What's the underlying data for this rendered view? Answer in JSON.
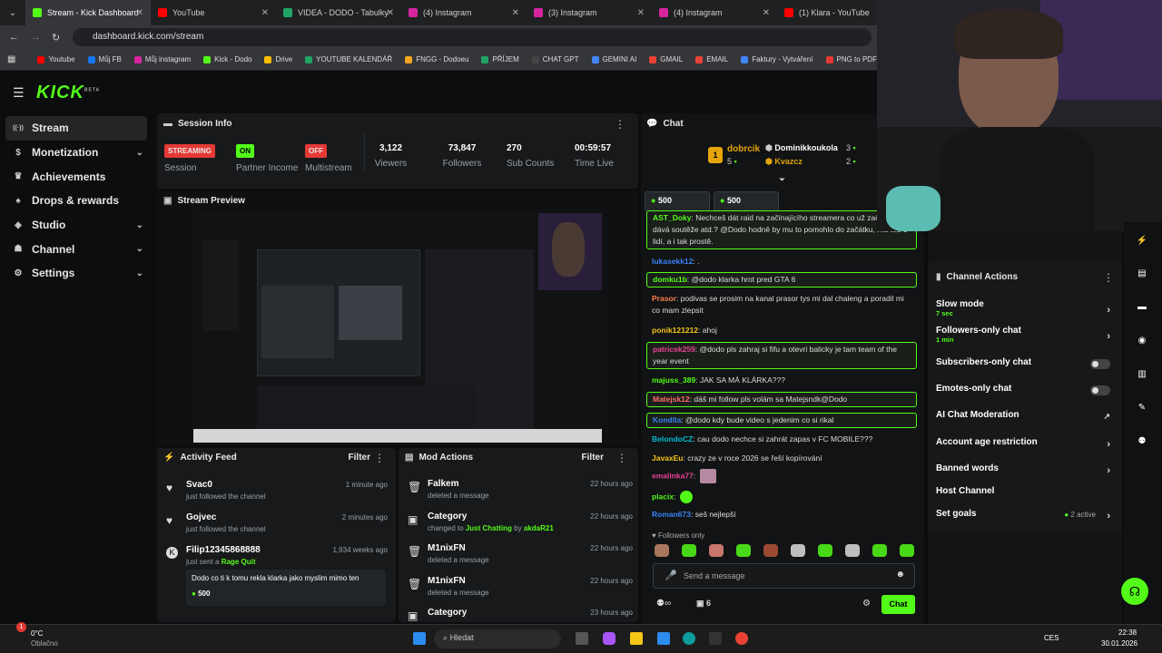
{
  "browser": {
    "tabs": [
      {
        "label": "Stream - Kick Dashboard",
        "color": "#53fc18",
        "active": true
      },
      {
        "label": "YouTube",
        "color": "#ff0000"
      },
      {
        "label": "VIDEA - DODO - Tabulky",
        "color": "#1fa463"
      },
      {
        "label": "(4) Instagram",
        "color": "#d6249f"
      },
      {
        "label": "(3) Instagram",
        "color": "#d6249f"
      },
      {
        "label": "(4) Instagram",
        "color": "#d6249f"
      },
      {
        "label": "(1) Klara - YouTube",
        "color": "#ff0000"
      }
    ],
    "url": "dashboard.kick.com/stream",
    "bookmarks": [
      {
        "label": "Youtube",
        "color": "#ff0000"
      },
      {
        "label": "Můj FB",
        "color": "#1877f2"
      },
      {
        "label": "Můj instagram",
        "color": "#d6249f"
      },
      {
        "label": "Kick - Dodo",
        "color": "#53fc18"
      },
      {
        "label": "Drive",
        "color": "#fbbc04"
      },
      {
        "label": "YOUTUBE KALENDÁŘ",
        "color": "#1fa463"
      },
      {
        "label": "FNGG - Dodoeu",
        "color": "#f5a623"
      },
      {
        "label": "PŘÍJEM",
        "color": "#1fa463"
      },
      {
        "label": "CHAT GPT",
        "color": "#444444"
      },
      {
        "label": "GEMINI AI",
        "color": "#4285f4"
      },
      {
        "label": "GMAIL",
        "color": "#ea4335"
      },
      {
        "label": "EMAIL",
        "color": "#ea4335"
      },
      {
        "label": "Faktury - Vytváření",
        "color": "#4285f4"
      },
      {
        "label": "PNG to PDF",
        "color": "#e53935"
      }
    ]
  },
  "brand": {
    "logo": "KICK",
    "beta": "BETA",
    "accent": "#53fc18"
  },
  "sidebar": {
    "items": [
      {
        "label": "Stream",
        "icon": "broadcast-icon",
        "chev": ""
      },
      {
        "label": "Monetization",
        "icon": "dollar-icon",
        "chev": "⌄"
      },
      {
        "label": "Achievements",
        "icon": "trophy-icon",
        "chev": ""
      },
      {
        "label": "Drops & rewards",
        "icon": "gift-icon",
        "chev": ""
      },
      {
        "label": "Studio",
        "icon": "studio-icon",
        "chev": "⌄"
      },
      {
        "label": "Channel",
        "icon": "channel-icon",
        "chev": "⌄"
      },
      {
        "label": "Settings",
        "icon": "gear-icon",
        "chev": "⌄"
      }
    ]
  },
  "session": {
    "title": "Session Info",
    "streaming": "STREAMING",
    "session_label": "Session",
    "on": "ON",
    "partner_label": "Partner Income",
    "off": "OFF",
    "multistream_label": "Multistream",
    "viewers": "3,122",
    "viewers_label": "Viewers",
    "followers": "73,847",
    "followers_label": "Followers",
    "subs": "270",
    "subs_label": "Sub Counts",
    "time": "00:59:57",
    "time_label": "Time Live"
  },
  "preview": {
    "title": "Stream Preview"
  },
  "activity": {
    "title": "Activity Feed",
    "filter": "Filter",
    "items": [
      {
        "name": "Svac0",
        "sub": "just followed the channel",
        "time": "1 minute ago"
      },
      {
        "name": "Gojvec",
        "sub": "just followed the channel",
        "time": "2 minutes ago"
      },
      {
        "name": "Filip12345868888",
        "sub": "just sent a",
        "sub2": "Rage Quit",
        "time": "1,934 weeks ago",
        "msg": "Dodo co ti k tomu rekla klarka jako myslim mimo ten",
        "amount": "500"
      }
    ]
  },
  "mod": {
    "title": "Mod Actions",
    "filter": "Filter",
    "items": [
      {
        "name": "Falkem",
        "sub": "deleted a message",
        "time": "22 hours ago"
      },
      {
        "name": "Category",
        "sub": "changed to",
        "sub2": "Just Chatting",
        "sub3": "by",
        "sub4": "akdaR21",
        "time": "22 hours ago"
      },
      {
        "name": "M1nixFN",
        "sub": "deleted a message",
        "time": "22 hours ago"
      },
      {
        "name": "M1nixFN",
        "sub": "deleted a message",
        "time": "22 hours ago"
      },
      {
        "name": "Category",
        "sub": "",
        "time": "23 hours ago"
      }
    ]
  },
  "chat": {
    "title": "Chat",
    "leaders": [
      {
        "rank": "1",
        "name": "dobrcik",
        "count": "5"
      },
      {
        "name": "Dominikkoukola",
        "count": "3"
      },
      {
        "name": "Kvazcz",
        "count": "2"
      }
    ],
    "pins": [
      "500",
      "500"
    ],
    "messages": [
      {
        "user": "AST_Doky",
        "text": "Nechceš dát raid na začínajícího streamera co už začátku dává soutěže atd.? @Dodo hodně by mu to pomohlo do začátku, má teď 9 lidí, a i tak prostě.",
        "color": "#53fc18",
        "hl": true
      },
      {
        "user": "lukasekk12",
        "text": ".",
        "color": "#3b82f6",
        "hl": false
      },
      {
        "user": "domku1b",
        "text": "@dodo klarka hrot pred GTA 6",
        "color": "#53fc18",
        "hl": true
      },
      {
        "user": "Prasor",
        "text": "podivas se prosim na kanal prasor tys mi dal chaleng a poradil mi co mam zlepsit",
        "color": "#ff7f50",
        "hl": false
      },
      {
        "user": "ponik121212",
        "text": "ahoj",
        "color": "#f5c518",
        "hl": false
      },
      {
        "user": "patricek259",
        "text": "@dodo pls zahraj si fifu a otevri balicky je tam team of the year event",
        "color": "#e84393",
        "hl": true
      },
      {
        "user": "majuss_389",
        "text": "JAK SA MÁ KLÁRKA???",
        "color": "#53fc18",
        "hl": false
      },
      {
        "user": "Matejsk12",
        "text": "dáš mi follow pls volám sa Matejsndk@Dodo",
        "color": "#ff6b6b",
        "hl": true
      },
      {
        "user": "Kondlla",
        "text": "@dodo kdy bude video s jedenim co si rikal",
        "color": "#3b82f6",
        "hl": true
      },
      {
        "user": "BelondoCZ",
        "text": "cau dodo nechce si zahrát zapas v FC MOBILE???",
        "color": "#00bcd4",
        "hl": false
      },
      {
        "user": "JavaxEu",
        "text": "crazy ze v roce 2026 se řeší kopírování",
        "color": "#f5c518",
        "hl": false
      },
      {
        "user": "emalinka77",
        "text": "",
        "color": "#e84393",
        "hl": false
      },
      {
        "user": "placix",
        "text": "",
        "color": "#53fc18",
        "hl": false
      },
      {
        "user": "Roman673",
        "text": "seš nejlepší",
        "color": "#3b82f6",
        "hl": false
      }
    ],
    "followers_only": "Followers only",
    "placeholder": "Send a message",
    "count": "6",
    "send": "Chat"
  },
  "actions": {
    "title": "Channel Actions",
    "items": [
      {
        "label": "Slow mode",
        "sub": "7 sec",
        "ctrl": "chev"
      },
      {
        "label": "Followers-only chat",
        "sub": "1 min",
        "ctrl": "chev"
      },
      {
        "label": "Subscribers-only chat",
        "sub": "",
        "ctrl": "toggle"
      },
      {
        "label": "Emotes-only chat",
        "sub": "",
        "ctrl": "toggle"
      },
      {
        "label": "AI Chat Moderation",
        "sub": "",
        "ctrl": "ext"
      },
      {
        "label": "Account age restriction",
        "sub": "",
        "ctrl": "chev"
      },
      {
        "label": "Banned words",
        "sub": "",
        "ctrl": "chev"
      },
      {
        "label": "Host Channel",
        "sub": "",
        "ctrl": ""
      },
      {
        "label": "Set goals",
        "sub": "",
        "ctrl": "chev",
        "status": "2 active"
      }
    ]
  },
  "taskbar": {
    "temp": "0°C",
    "weather": "Oblačno",
    "search": "Hledat",
    "lang": "CES",
    "time": "22:38",
    "date": "30.01.2026"
  }
}
